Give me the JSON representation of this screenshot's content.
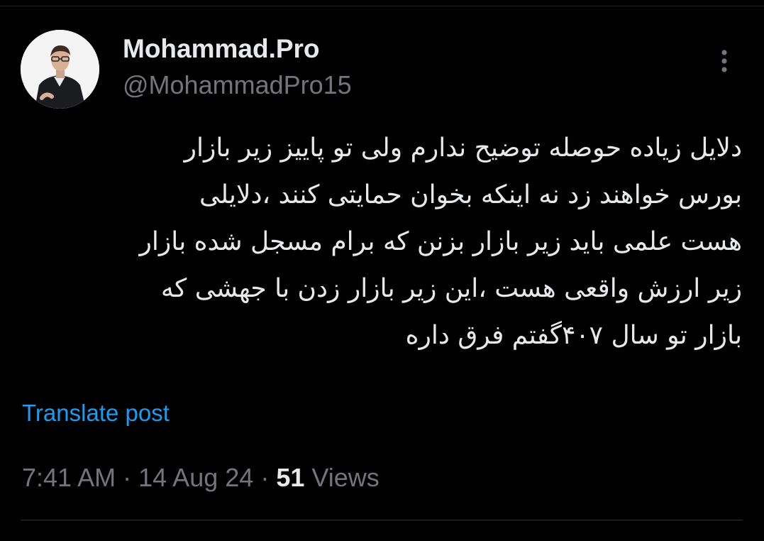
{
  "colors": {
    "background": "#000000",
    "primary_text": "#e7e9ea",
    "secondary_text": "#71767b",
    "link": "#1d9bf0",
    "divider": "#2f3336"
  },
  "author": {
    "display_name": "Mohammad.Pro",
    "handle": "@MohammadPro15",
    "avatar_icon": "profile-photo"
  },
  "more_icon": "more-vertical-icon",
  "tweet": {
    "lines": [
      "دلایل زیاده حوصله توضیح ندارم ولی تو پاییز زیر بازار",
      "بورس خواهند زد نه اینکه بخوان حمایتی کنند ،دلایلی",
      "هست علمی باید زیر بازار بزنن که برام مسجل شده بازار",
      "زیر ارزش واقعی هست ،این زیر بازار زدن با جهشی که",
      "بازار تو سال ۴۰۷گفتم فرق داره"
    ]
  },
  "translate_label": "Translate post",
  "meta": {
    "time": "7:41 AM",
    "separator": "·",
    "date": "14 Aug 24",
    "views_count": "51",
    "views_label": "Views"
  }
}
